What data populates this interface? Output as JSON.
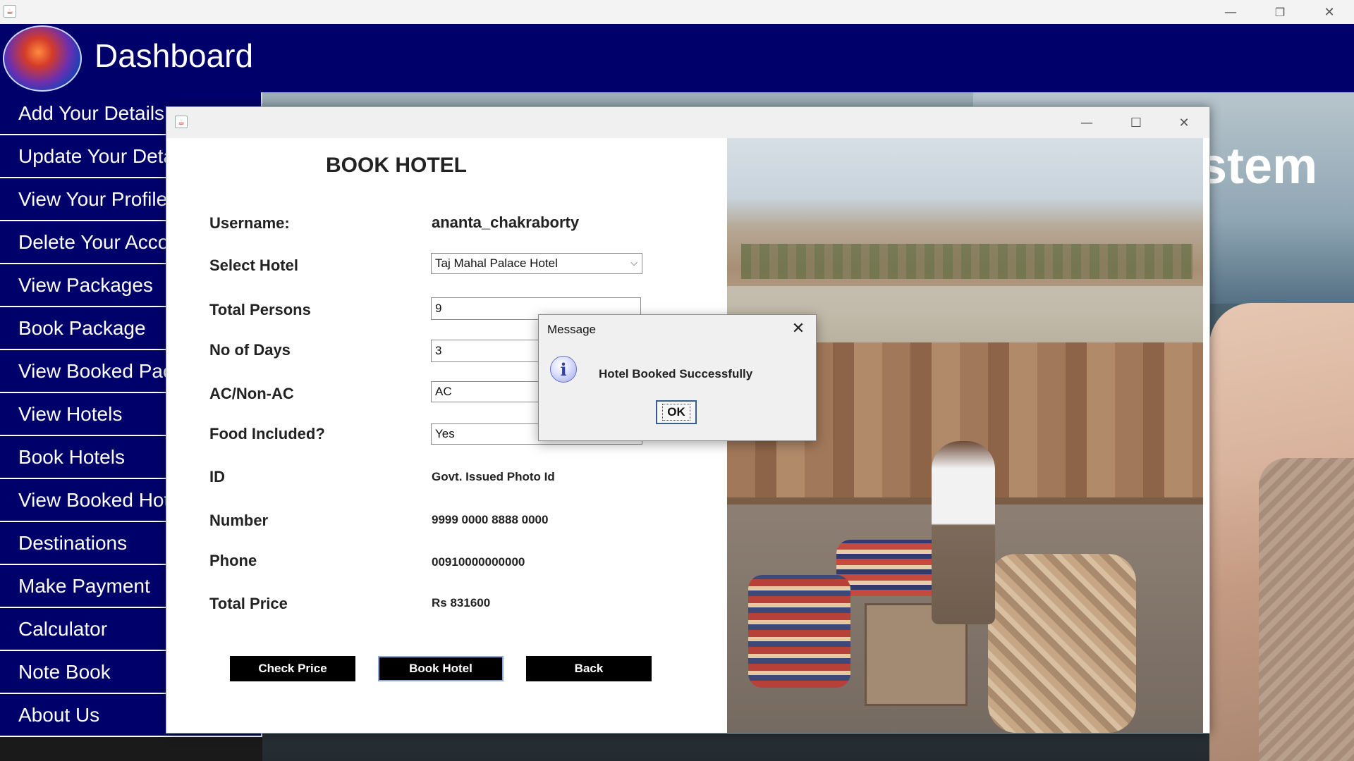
{
  "outer_window": {
    "title": "",
    "minimize": "—",
    "restore": "❐",
    "close": "✕"
  },
  "header": {
    "title": "Dashboard"
  },
  "background": {
    "caption_fragment": "stem"
  },
  "sidebar": {
    "items": [
      {
        "label": "Add Your Details"
      },
      {
        "label": "Update Your Details"
      },
      {
        "label": "View Your Profile"
      },
      {
        "label": "Delete Your Account"
      },
      {
        "label": "View Packages"
      },
      {
        "label": "Book Package"
      },
      {
        "label": "View Booked Package"
      },
      {
        "label": "View Hotels"
      },
      {
        "label": "Book Hotels"
      },
      {
        "label": "View Booked Hotel"
      },
      {
        "label": "Destinations"
      },
      {
        "label": "Make Payment"
      },
      {
        "label": "Calculator"
      },
      {
        "label": "Note Book"
      },
      {
        "label": "About Us"
      }
    ]
  },
  "dialog": {
    "title": "BOOK HOTEL",
    "window_controls": {
      "minimize": "—",
      "maximize": "☐",
      "close": "✕"
    },
    "fields": {
      "username": {
        "label": "Username:",
        "value": "ananta_chakraborty"
      },
      "hotel": {
        "label": "Select Hotel",
        "value": "Taj Mahal Palace Hotel"
      },
      "persons": {
        "label": "Total Persons",
        "value": "9"
      },
      "days": {
        "label": "No of Days",
        "value": "3"
      },
      "ac": {
        "label": "AC/Non-AC",
        "value": "AC"
      },
      "food": {
        "label": "Food Included?",
        "value": "Yes"
      },
      "id": {
        "label": "ID",
        "value": "Govt. Issued Photo Id"
      },
      "number": {
        "label": "Number",
        "value": "9999 0000 8888 0000"
      },
      "phone": {
        "label": "Phone",
        "value": "00910000000000"
      },
      "price": {
        "label": "Total Price",
        "value": "Rs 831600"
      }
    },
    "buttons": {
      "check_price": "Check Price",
      "book_hotel": "Book Hotel",
      "back": "Back"
    }
  },
  "message_box": {
    "title": "Message",
    "text": "Hotel Booked Successfully",
    "ok": "OK",
    "icon": "information-icon"
  },
  "colors": {
    "header_bg": "#00006b",
    "sidebar_bg": "#00006b",
    "button_bg": "#000000"
  }
}
